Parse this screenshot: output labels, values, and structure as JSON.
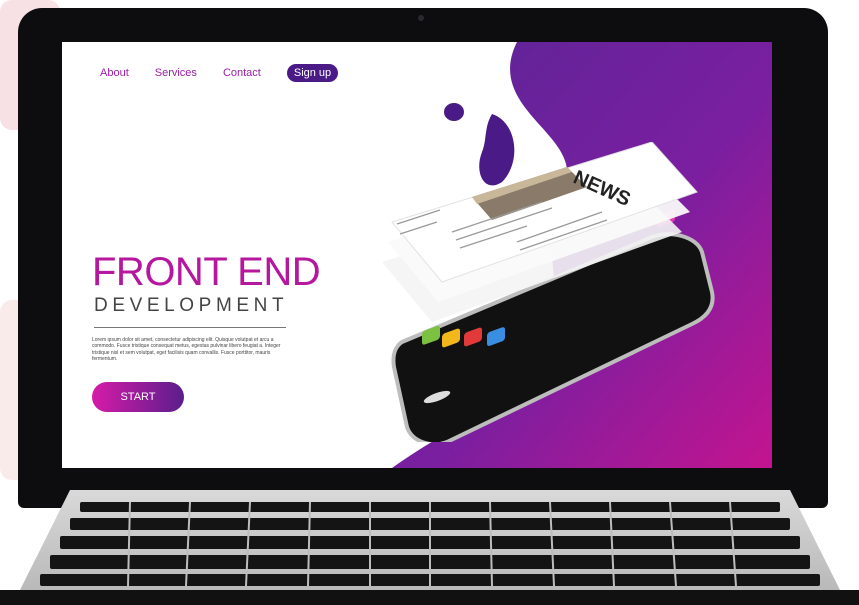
{
  "nav": {
    "items": [
      "About",
      "Services",
      "Contact"
    ],
    "signup_label": "Sign up"
  },
  "hero": {
    "title_line1": "FRONT END",
    "title_line2": "DEVELOPMENT",
    "paragraph": "Lorem ipsum dolor sit amet, consectetur adipiscing elit. Quisque volutpat et arcu a commodo. Fusce tristique consequat metus, egestas pulvinar libero feugiat a. Integer tristique nisl et sem volutpat, eget facilisis quam convallis. Fusce porttitor, mauris fermentum.",
    "start_label": "START"
  },
  "phone": {
    "card_title": "NEWS"
  },
  "colors": {
    "accent_magenta": "#b5179e",
    "accent_purple": "#4a1b86",
    "gradient_start": "#d61ba8",
    "gradient_end": "#5a1e8c"
  }
}
